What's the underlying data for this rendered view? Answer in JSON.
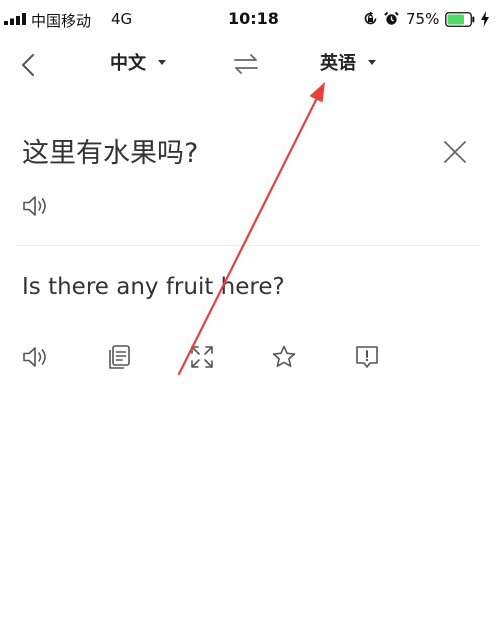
{
  "status_bar": {
    "carrier": "中国移动",
    "network": "4G",
    "time": "10:18",
    "battery_percent": "75%",
    "battery_level": 0.75,
    "icons": [
      "signal-icon",
      "orientation-lock-icon",
      "alarm-icon",
      "battery-icon",
      "charging-icon"
    ]
  },
  "nav": {
    "source_language": "中文",
    "target_language": "英语",
    "icons": [
      "back-icon",
      "swap-languages-icon",
      "dropdown-caret-icon"
    ]
  },
  "source": {
    "text": "这里有水果吗?",
    "icons": [
      "speaker-icon",
      "close-icon"
    ]
  },
  "translation": {
    "text": "Is there any fruit here?",
    "actions": [
      "speaker-icon",
      "copy-icon",
      "fullscreen-icon",
      "star-icon",
      "report-icon"
    ]
  },
  "colors": {
    "text": "#333333",
    "icon": "#555555",
    "battery": "#4cd964",
    "annotation_arrow": "#e8403a"
  }
}
